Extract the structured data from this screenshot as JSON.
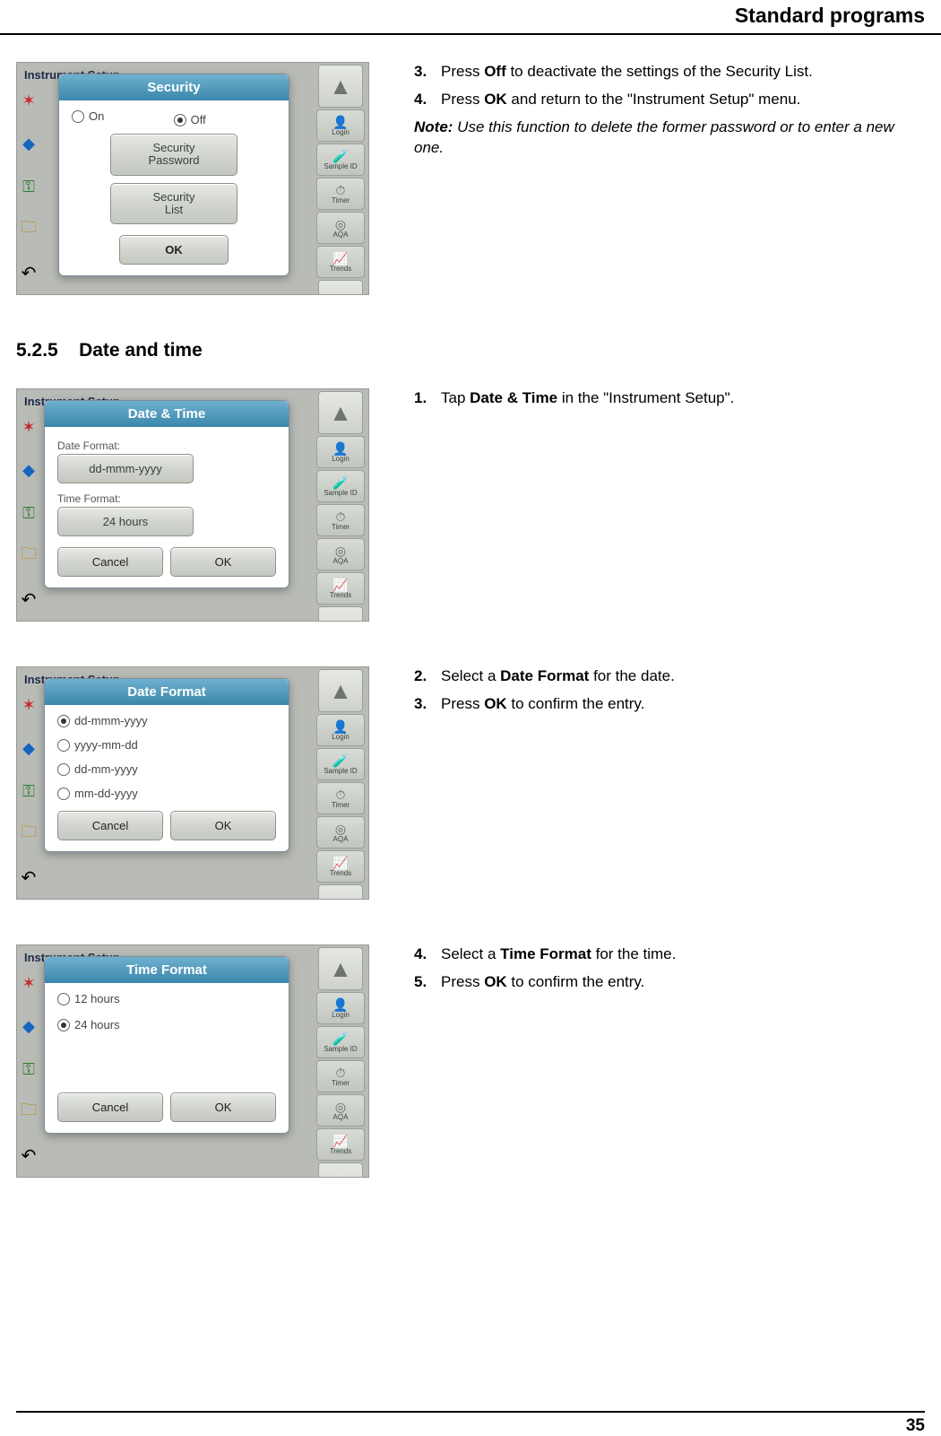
{
  "header": {
    "title": "Standard programs"
  },
  "footer": {
    "page": "35"
  },
  "section": {
    "number": "5.2.5",
    "title": "Date and time"
  },
  "right_toolbar": {
    "login": "Login",
    "sample_id": "Sample ID",
    "timer": "Timer",
    "aqa": "AQA",
    "trends": "Trends"
  },
  "bg": {
    "instrument": "Instrument Setup",
    "t": "t"
  },
  "sec1": {
    "dialog_title": "Security",
    "on": "On",
    "off": "Off",
    "pw_btn": "Security\nPassword",
    "list_btn": "Security\nList",
    "ok": "OK",
    "step3_pre": "Press ",
    "step3_b": "Off",
    "step3_post": " to deactivate the settings of the Security List.",
    "step4_pre": "Press ",
    "step4_b": "OK",
    "step4_post": " and return to the \"Instrument Setup\" menu.",
    "note_label": "Note:",
    "note_text": " Use this function to delete the former password or to enter a new one."
  },
  "sec2": {
    "dialog_title": "Date & Time",
    "date_format_label": "Date Format:",
    "date_format_value": "dd-mmm-yyyy",
    "time_format_label": "Time Format:",
    "time_format_value": "24 hours",
    "cancel": "Cancel",
    "ok": "OK",
    "step1_pre": "Tap ",
    "step1_b": "Date & Time",
    "step1_post": " in the \"Instrument Setup\"."
  },
  "sec3": {
    "dialog_title": "Date Format",
    "opt1": "dd-mmm-yyyy",
    "opt2": "yyyy-mm-dd",
    "opt3": "dd-mm-yyyy",
    "opt4": "mm-dd-yyyy",
    "cancel": "Cancel",
    "ok": "OK",
    "step2_pre": "Select a ",
    "step2_b": "Date Format",
    "step2_post": " for the date.",
    "step3_pre": "Press ",
    "step3_b": "OK",
    "step3_post": " to confirm the entry."
  },
  "sec4": {
    "dialog_title": "Time Format",
    "opt1": "12 hours",
    "opt2": "24 hours",
    "cancel": "Cancel",
    "ok": "OK",
    "step4_pre": "Select a ",
    "step4_b": "Time Format",
    "step4_post": " for the time.",
    "step5_pre": "Press ",
    "step5_b": "OK",
    "step5_post": " to confirm the entry."
  }
}
